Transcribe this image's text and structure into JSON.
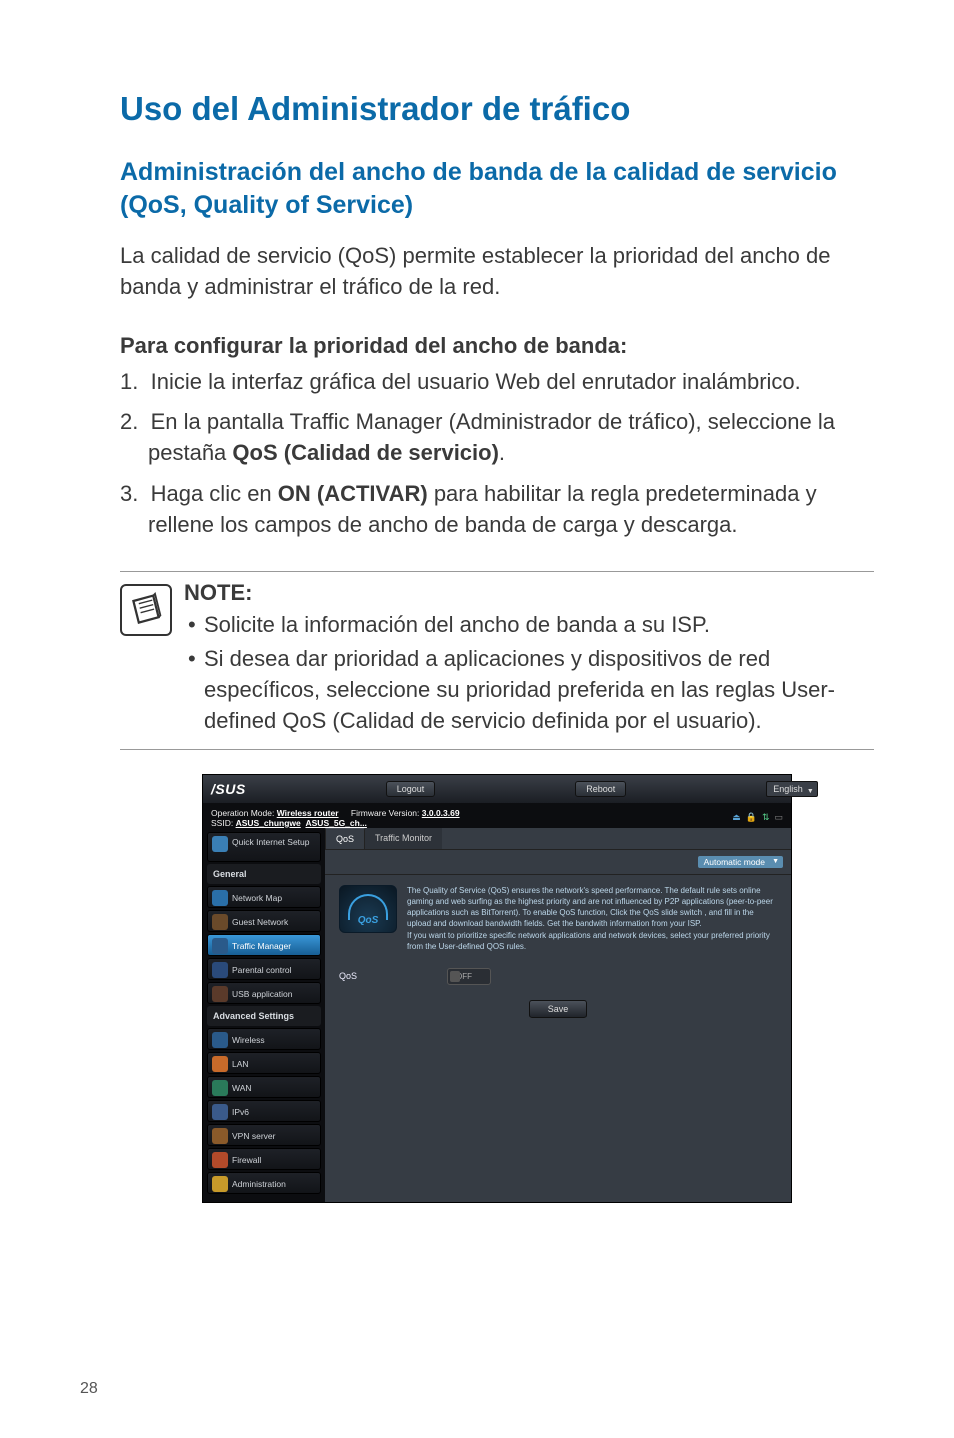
{
  "page_number": "28",
  "title": "Uso del Administrador de tráfico",
  "subtitle": "Administración del ancho de banda de la calidad de servicio (QoS, Quality of Service)",
  "intro": "La calidad de servicio (QoS) permite establecer la prioridad del ancho de banda y administrar el tráfico de la red.",
  "steps_heading": "Para configurar la prioridad del ancho de banda:",
  "steps": [
    {
      "num": "1.",
      "text": "Inicie la interfaz gráfica del usuario Web del enrutador inalámbrico."
    },
    {
      "num": "2.",
      "pre": "En la pantalla Traffic Manager (Administrador de tráfico), seleccione la pestaña ",
      "bold": "QoS (Calidad de servicio)",
      "post": "."
    },
    {
      "num": "3.",
      "pre": "Haga clic en ",
      "bold": "ON (ACTIVAR)",
      "post": " para habilitar la regla predeterminada y rellene los campos de ancho de banda de carga y descarga."
    }
  ],
  "note_label": "NOTE:",
  "note_items": [
    "Solicite la información del ancho de banda a su ISP.",
    "Si desea dar prioridad a aplicaciones y dispositivos de red específicos, seleccione su prioridad preferida en las reglas User-defined QoS (Calidad de servicio definida por el usuario)."
  ],
  "router": {
    "logo": "/SUS",
    "logout": "Logout",
    "reboot": "Reboot",
    "language": "English",
    "op_mode_label": "Operation Mode:",
    "op_mode_value": "Wireless router",
    "fw_label": "Firmware Version:",
    "fw_value": "3.0.0.3.69",
    "ssid_label": "SSID:",
    "ssid1": "ASUS_chungwe",
    "ssid2": "ASUS_5G_ch...",
    "tabs": {
      "qos": "QoS",
      "traffic_monitor": "Traffic Monitor"
    },
    "mode": "Automatic mode",
    "sidebar": {
      "quick": "Quick Internet Setup",
      "general": "General",
      "items_general": [
        "Network Map",
        "Guest Network",
        "Traffic Manager",
        "Parental control",
        "USB application"
      ],
      "advanced": "Advanced Settings",
      "items_advanced": [
        "Wireless",
        "LAN",
        "WAN",
        "IPv6",
        "VPN server",
        "Firewall",
        "Administration"
      ]
    },
    "desc": "The Quality of Service (QoS) ensures the network's speed performance. The default rule sets online gaming and web surfing as the highest priority and are not influenced by P2P applications (peer-to-peer applications such as BitTorrent). To enable QoS function, Click the QoS slide switch , and fill in the upload and download bandwidth fields. Get the bandwith information from your ISP.\nIf you want to prioritize specific network applications and network devices, select your preferred priority from the User-defined QOS rules.",
    "gauge_label": "QoS",
    "qos_field_label": "QoS",
    "qos_toggle": "OFF",
    "save": "Save"
  }
}
